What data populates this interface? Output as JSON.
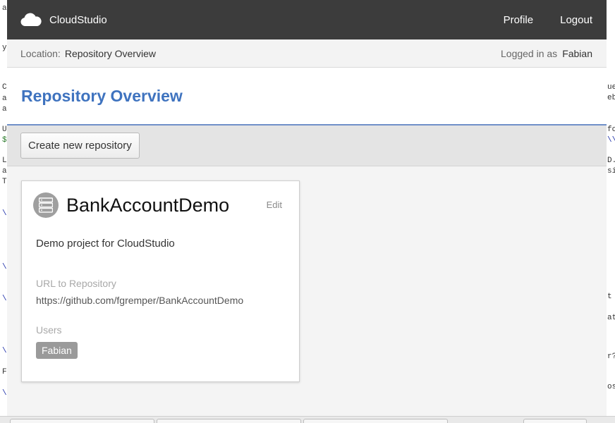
{
  "app": {
    "name": "CloudStudio",
    "logo_icon": "cloud-icon"
  },
  "nav": {
    "profile": "Profile",
    "logout": "Logout"
  },
  "location": {
    "label": "Location:",
    "value": "Repository Overview"
  },
  "login": {
    "label": "Logged in as",
    "user": "Fabian"
  },
  "page": {
    "title": "Repository Overview"
  },
  "toolbar": {
    "create_label": "Create new repository"
  },
  "repositories": [
    {
      "icon": "server-icon",
      "name": "BankAccountDemo",
      "edit_label": "Edit",
      "description": "Demo project for CloudStudio",
      "url_label": "URL to Repository",
      "url": "https://github.com/fgremper/BankAccountDemo",
      "users_label": "Users",
      "users": [
        "Fabian"
      ]
    }
  ],
  "colors": {
    "topbar": "#3c3c3c",
    "title_accent": "#3f73bf",
    "badge": "#9a9a9a"
  }
}
